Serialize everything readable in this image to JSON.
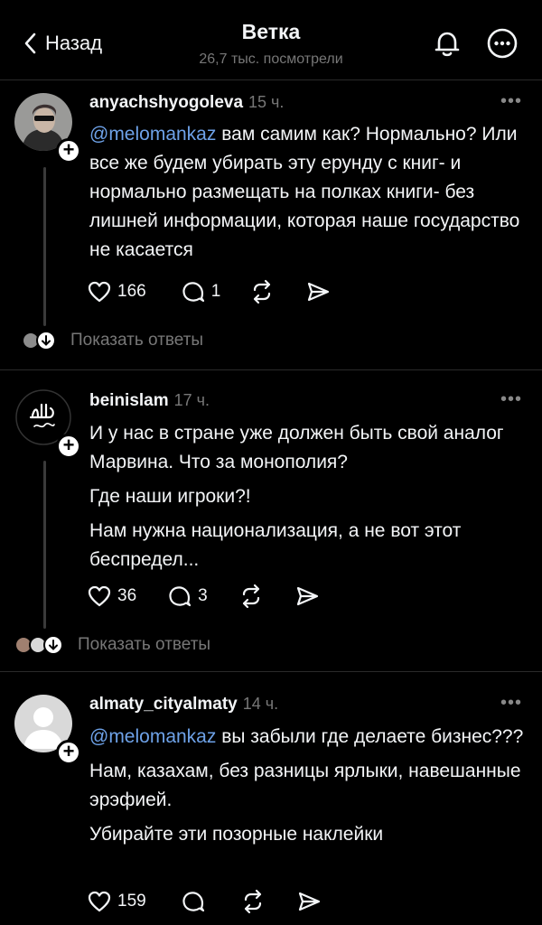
{
  "header": {
    "back_label": "Назад",
    "title": "Ветка",
    "views": "26,7 тыс. посмотрели"
  },
  "posts": [
    {
      "username": "anyachshyogoleva",
      "time": "15 ч.",
      "mention": "@melomankaz",
      "paragraphs": [
        "вам самим как? Нормально? Или все же будем убирать эту ерунду с книг- и нормально размещать на полках книги- без лишней информации, которая наше государство не касается"
      ],
      "likes": "166",
      "comments": "1",
      "show_replies": "Показать ответы"
    },
    {
      "username": "beinislam",
      "time": "17 ч.",
      "mention": "",
      "paragraphs": [
        "И у нас в стране уже должен быть свой аналог Марвина. Что за монополия?",
        "Где наши игроки?!",
        "Нам нужна национализация, а не вот этот беспредел..."
      ],
      "likes": "36",
      "comments": "3",
      "show_replies": "Показать ответы"
    },
    {
      "username": "almaty_cityalmaty",
      "time": "14 ч.",
      "mention": "@melomankaz",
      "paragraphs": [
        "вы забыли где делаете бизнес???",
        "Нам, казахам, без разницы ярлыки, навешанные эрэфией.",
        "Убирайте эти позорные наклейки"
      ],
      "likes": "159",
      "comments": ""
    }
  ],
  "icons": {
    "back": "chevron-left-icon",
    "bell": "bell-icon",
    "more": "more-icon",
    "like": "heart-icon",
    "comment": "comment-icon",
    "repost": "repost-icon",
    "share": "share-icon"
  },
  "colors": {
    "background": "#000000",
    "text": "#f3f5f7",
    "secondary": "#777777",
    "mention": "#6ea2e8"
  }
}
